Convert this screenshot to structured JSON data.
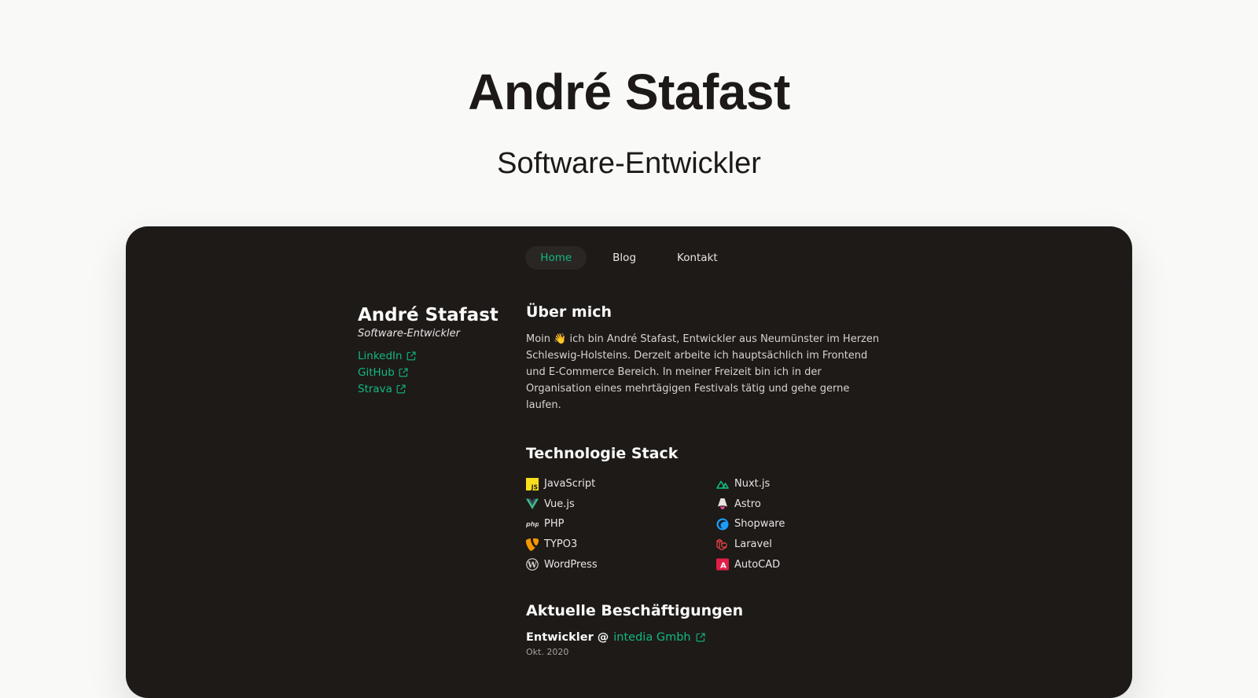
{
  "hero": {
    "title": "André Stafast",
    "subtitle": "Software-Entwickler"
  },
  "nav": {
    "items": [
      {
        "label": "Home",
        "active": true
      },
      {
        "label": "Blog",
        "active": false
      },
      {
        "label": "Kontakt",
        "active": false
      }
    ]
  },
  "sidebar": {
    "name": "André Stafast",
    "role": "Software-Entwickler",
    "links": [
      {
        "label": "LinkedIn",
        "icon": "external-link-icon"
      },
      {
        "label": "GitHub",
        "icon": "external-link-icon"
      },
      {
        "label": "Strava",
        "icon": "external-link-icon"
      }
    ]
  },
  "about": {
    "heading": "Über mich",
    "text": "Moin 👋 ich bin André Stafast, Entwickler aus Neumünster im Herzen Schleswig-Holsteins. Derzeit arbeite ich hauptsächlich im Frontend und E-Commerce Bereich. In meiner Freizeit bin ich in der Organisation eines mehrtägigen Festivals tätig und gehe gerne laufen."
  },
  "stack": {
    "heading": "Technologie Stack",
    "left": [
      {
        "label": "JavaScript",
        "icon": "javascript-icon"
      },
      {
        "label": "Vue.js",
        "icon": "vue-icon"
      },
      {
        "label": "PHP",
        "icon": "php-icon"
      },
      {
        "label": "TYPO3",
        "icon": "typo3-icon"
      },
      {
        "label": "WordPress",
        "icon": "wordpress-icon"
      }
    ],
    "right": [
      {
        "label": "Nuxt.js",
        "icon": "nuxt-icon"
      },
      {
        "label": "Astro",
        "icon": "astro-icon"
      },
      {
        "label": "Shopware",
        "icon": "shopware-icon"
      },
      {
        "label": "Laravel",
        "icon": "laravel-icon"
      },
      {
        "label": "AutoCAD",
        "icon": "autocad-icon"
      }
    ]
  },
  "jobs": {
    "heading": "Aktuelle Beschäftigungen",
    "items": [
      {
        "role": "Entwickler @",
        "company": "intedia Gmbh",
        "date": "Okt. 2020"
      }
    ]
  },
  "colors": {
    "accent": "#10b981",
    "frame_bg": "#1e1a18",
    "page_bg": "#f9f9f8"
  }
}
